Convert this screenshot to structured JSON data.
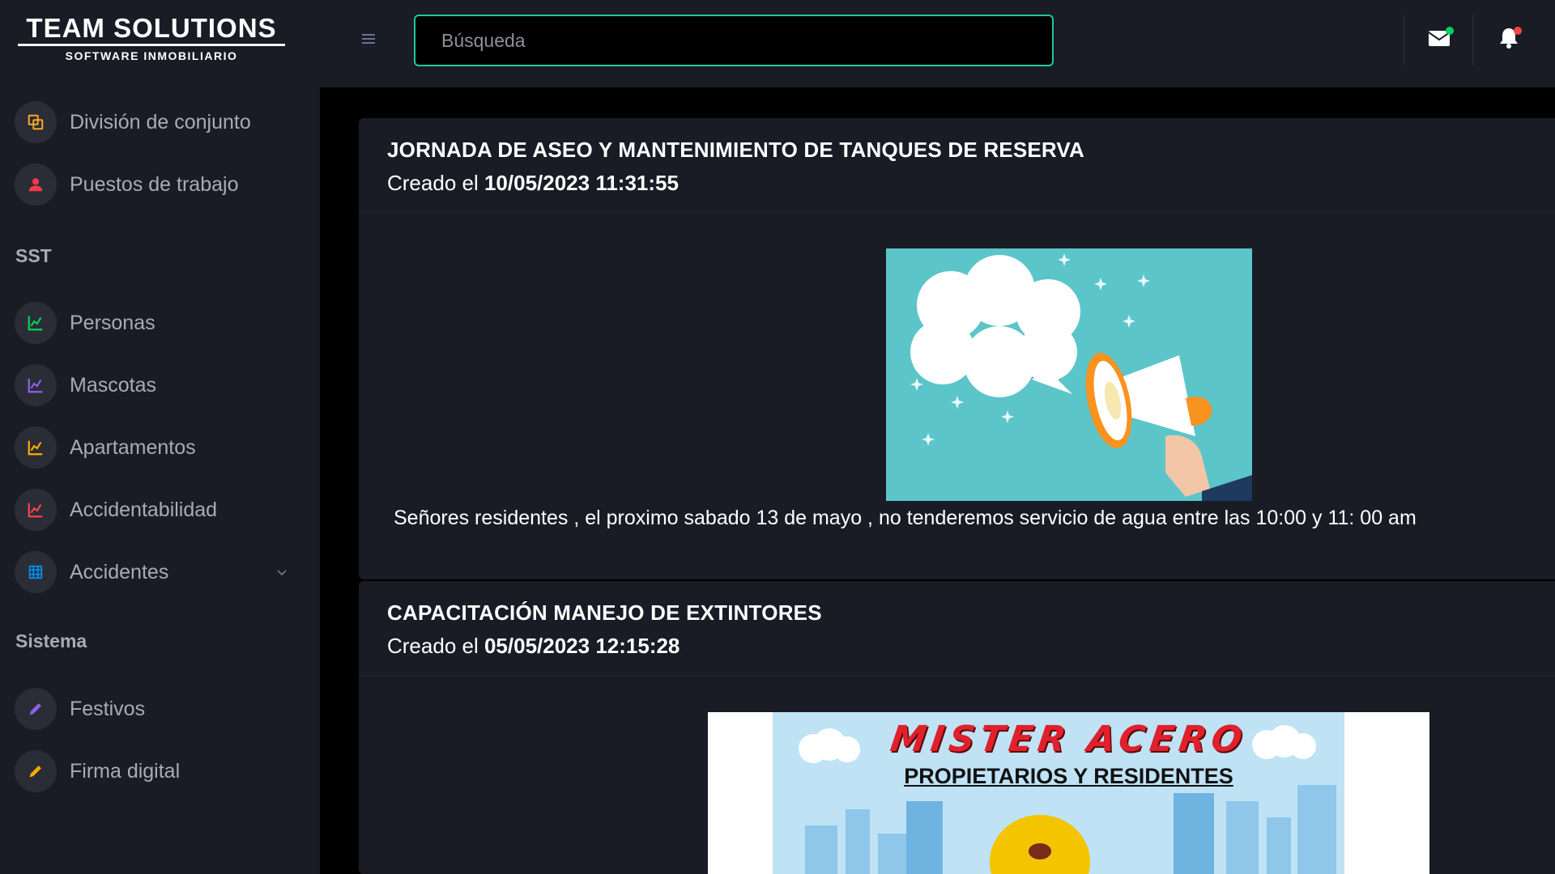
{
  "brand": {
    "title": "TEAM SOLUTIONS",
    "subtitle": "SOFTWARE INMOBILIARIO"
  },
  "sidebar": {
    "items_top": [
      {
        "label": "División de conjunto",
        "icon": "copy-icon",
        "color": "#f5a623"
      },
      {
        "label": "Puestos de trabajo",
        "icon": "user-icon",
        "color": "#f23b4c"
      }
    ],
    "sections": [
      {
        "title": "SST",
        "items": [
          {
            "label": "Personas",
            "icon": "chart-line-icon",
            "color": "#00d25b"
          },
          {
            "label": "Mascotas",
            "icon": "chart-line-icon",
            "color": "#8f5fe8"
          },
          {
            "label": "Apartamentos",
            "icon": "chart-line-icon",
            "color": "#ffab00"
          },
          {
            "label": "Accidentabilidad",
            "icon": "chart-line-icon",
            "color": "#fc424a"
          },
          {
            "label": "Accidentes",
            "icon": "grid-icon",
            "color": "#0090e7"
          }
        ]
      },
      {
        "title": "Sistema",
        "items": [
          {
            "label": "Festivos",
            "icon": "pencil-icon",
            "color": "#8f5fe8"
          },
          {
            "label": "Firma digital",
            "icon": "pencil-icon",
            "color": "#ffab00"
          }
        ]
      }
    ]
  },
  "topbar": {
    "search_placeholder": "Búsqueda",
    "mail_dot_color": "#00d25b",
    "bell_dot_color": "#fc424a"
  },
  "posts": [
    {
      "title": "JORNADA DE ASEO Y MANTENIMIENTO DE TANQUES DE RESERVA",
      "created_prefix": "Creado el",
      "created_at": "10/05/2023 11:31:55",
      "body": "Señores residentes , el proximo sabado 13 de mayo , no tenderemos servicio de agua entre las 10:00 y 11:  00 am"
    },
    {
      "title": "CAPACITACIÓN MANEJO DE EXTINTORES",
      "created_prefix": "Creado el",
      "created_at": "05/05/2023 12:15:28",
      "poster_title": "MISTER ACERO",
      "poster_subtitle": "PROPIETARIOS Y RESIDENTES"
    }
  ]
}
